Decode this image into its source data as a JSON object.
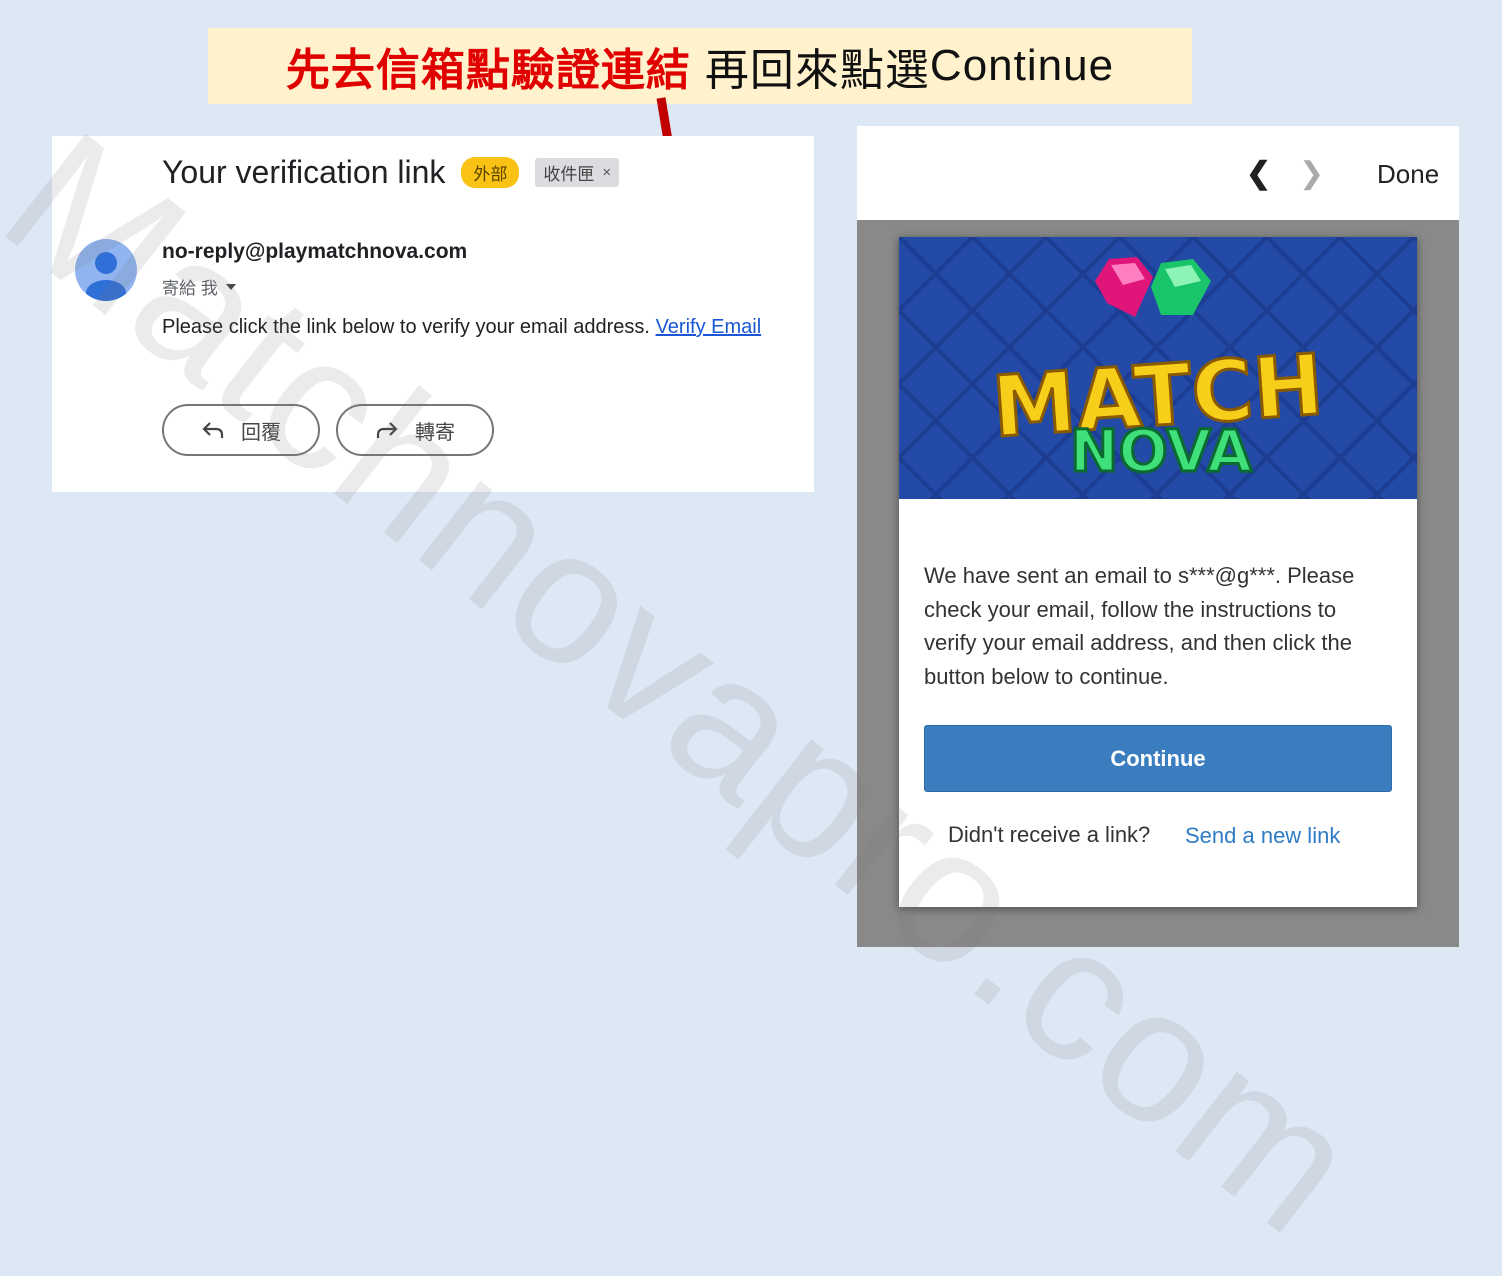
{
  "banner": {
    "red_text": "先去信箱點驗證連結",
    "black_text": "再回來點選",
    "latin_text": "Continue"
  },
  "email": {
    "subject": "Your verification link",
    "tag_external": "外部",
    "tag_inbox": "收件匣",
    "tag_inbox_close": "×",
    "sender": "no-reply@playmatchnova.com",
    "to_me": "寄給 我",
    "body": "Please click the link below to verify your email address.",
    "link_text": "Verify Email",
    "reply_label": "回覆",
    "forward_label": "轉寄"
  },
  "panel": {
    "prev": "❮",
    "next": "❯",
    "done": "Done",
    "logo_line1": "MATCH",
    "logo_line2": "NOVA",
    "message": "We have sent an email to s***@g***. Please check your email, follow the instructions to verify your email address, and then click the button below to continue.",
    "continue_label": "Continue",
    "didnt_receive": "Didn't receive a link?",
    "send_new_link": "Send a new link"
  },
  "watermark": "Matchnovapro.com",
  "colors": {
    "page_bg": "#dde8f5",
    "banner_bg": "#fff2cc",
    "banner_red": "#e00000",
    "tag_external": "#f9c214",
    "link_blue": "#1a57d6",
    "continue_blue": "#3a7ebf",
    "panel_gray": "#898989"
  }
}
